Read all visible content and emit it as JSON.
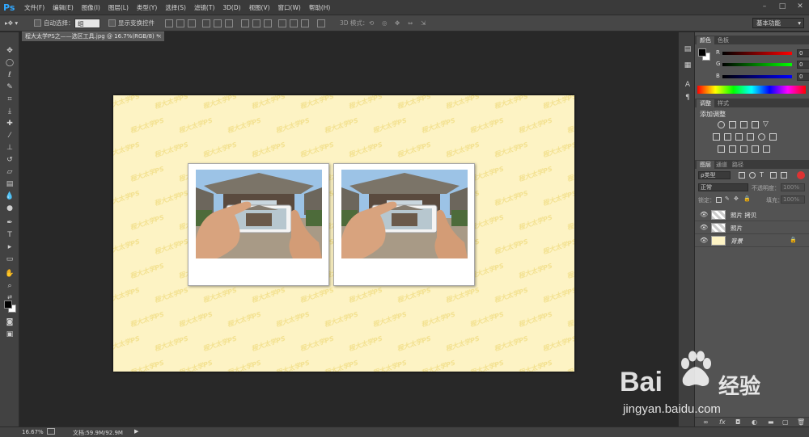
{
  "app": {
    "logo": "Ps"
  },
  "menu": [
    "文件(F)",
    "编辑(E)",
    "图像(I)",
    "图层(L)",
    "类型(Y)",
    "选择(S)",
    "滤镜(T)",
    "3D(D)",
    "视图(V)",
    "窗口(W)",
    "帮助(H)"
  ],
  "options_bar": {
    "auto_select_label": "自动选择：",
    "auto_select_value": "组",
    "show_transform_label": "显示变换控件",
    "mode3d_label": "3D 模式：",
    "workspace": "基本功能"
  },
  "document": {
    "tab_title": "程大太学PS之——选区工具.jpg @ 16.7%(RGB/8) *",
    "close_symbol": "×",
    "watermark_text": "程大太学PS"
  },
  "panels": {
    "color": {
      "tabs": [
        "颜色",
        "色板"
      ],
      "channels": [
        {
          "label": "R",
          "value": "0"
        },
        {
          "label": "G",
          "value": "0"
        },
        {
          "label": "B",
          "value": "0"
        }
      ]
    },
    "adjustments": {
      "tabs": [
        "调整",
        "样式"
      ],
      "title": "添加调整"
    },
    "layers": {
      "tabs": [
        "图层",
        "通道",
        "路径"
      ],
      "filter_label": "ρ类型",
      "blend_mode": "正常",
      "opacity_label": "不透明度：",
      "opacity_value": "100%",
      "lock_label": "锁定：",
      "fill_label": "填充：",
      "fill_value": "100%",
      "items": [
        {
          "name": "照片 拷贝"
        },
        {
          "name": "照片"
        },
        {
          "name": "背景"
        }
      ]
    }
  },
  "status": {
    "zoom": "16.67%",
    "doc_info": "文档:59.9M/92.9M"
  },
  "watermark": {
    "brand": "Bai",
    "brand_suffix": "经验",
    "url": "jingyan.baidu.com"
  },
  "colors": {
    "accent": "#31a8ff",
    "canvas_bg": "#fdf3c4",
    "workspace_bg": "#282828"
  }
}
